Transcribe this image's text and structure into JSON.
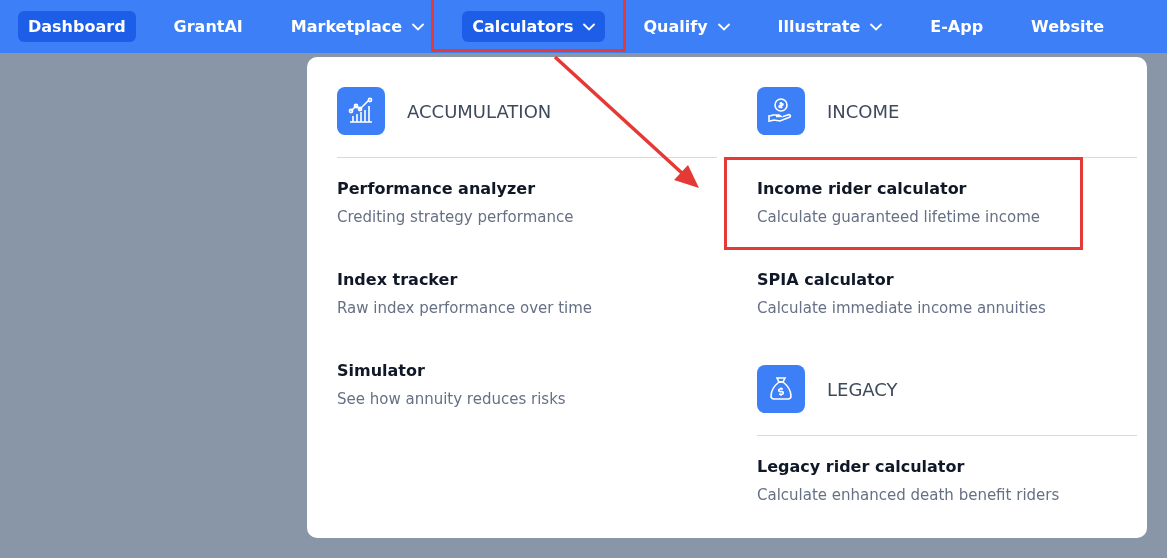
{
  "nav": {
    "items": [
      {
        "label": "Dashboard",
        "selected": true,
        "has_dropdown": false,
        "highlighted": false
      },
      {
        "label": "GrantAI",
        "selected": false,
        "has_dropdown": false,
        "highlighted": false
      },
      {
        "label": "Marketplace",
        "selected": false,
        "has_dropdown": true,
        "highlighted": false
      },
      {
        "label": "Calculators",
        "selected": true,
        "has_dropdown": true,
        "highlighted": true
      },
      {
        "label": "Qualify",
        "selected": false,
        "has_dropdown": true,
        "highlighted": false
      },
      {
        "label": "Illustrate",
        "selected": false,
        "has_dropdown": true,
        "highlighted": false
      },
      {
        "label": "E-App",
        "selected": false,
        "has_dropdown": false,
        "highlighted": false
      },
      {
        "label": "Website",
        "selected": false,
        "has_dropdown": false,
        "highlighted": false
      }
    ]
  },
  "dropdown": {
    "columns": [
      {
        "groups": [
          {
            "title": "ACCUMULATION",
            "kind": "chart",
            "items": [
              {
                "title": "Performance analyzer",
                "description": "Crediting strategy performance",
                "highlighted": false
              },
              {
                "title": "Index tracker",
                "description": "Raw index performance over time",
                "highlighted": false
              },
              {
                "title": "Simulator",
                "description": "See how annuity reduces risks",
                "highlighted": false
              }
            ]
          }
        ]
      },
      {
        "groups": [
          {
            "title": "INCOME",
            "kind": "hand",
            "items": [
              {
                "title": "Income rider calculator",
                "description": "Calculate guaranteed lifetime income",
                "highlighted": true
              },
              {
                "title": "SPIA calculator",
                "description": "Calculate immediate income annuities",
                "highlighted": false
              }
            ]
          },
          {
            "title": "LEGACY",
            "kind": "bag",
            "items": [
              {
                "title": "Legacy rider calculator",
                "description": "Calculate enhanced death benefit riders",
                "highlighted": false
              }
            ]
          }
        ]
      }
    ]
  }
}
